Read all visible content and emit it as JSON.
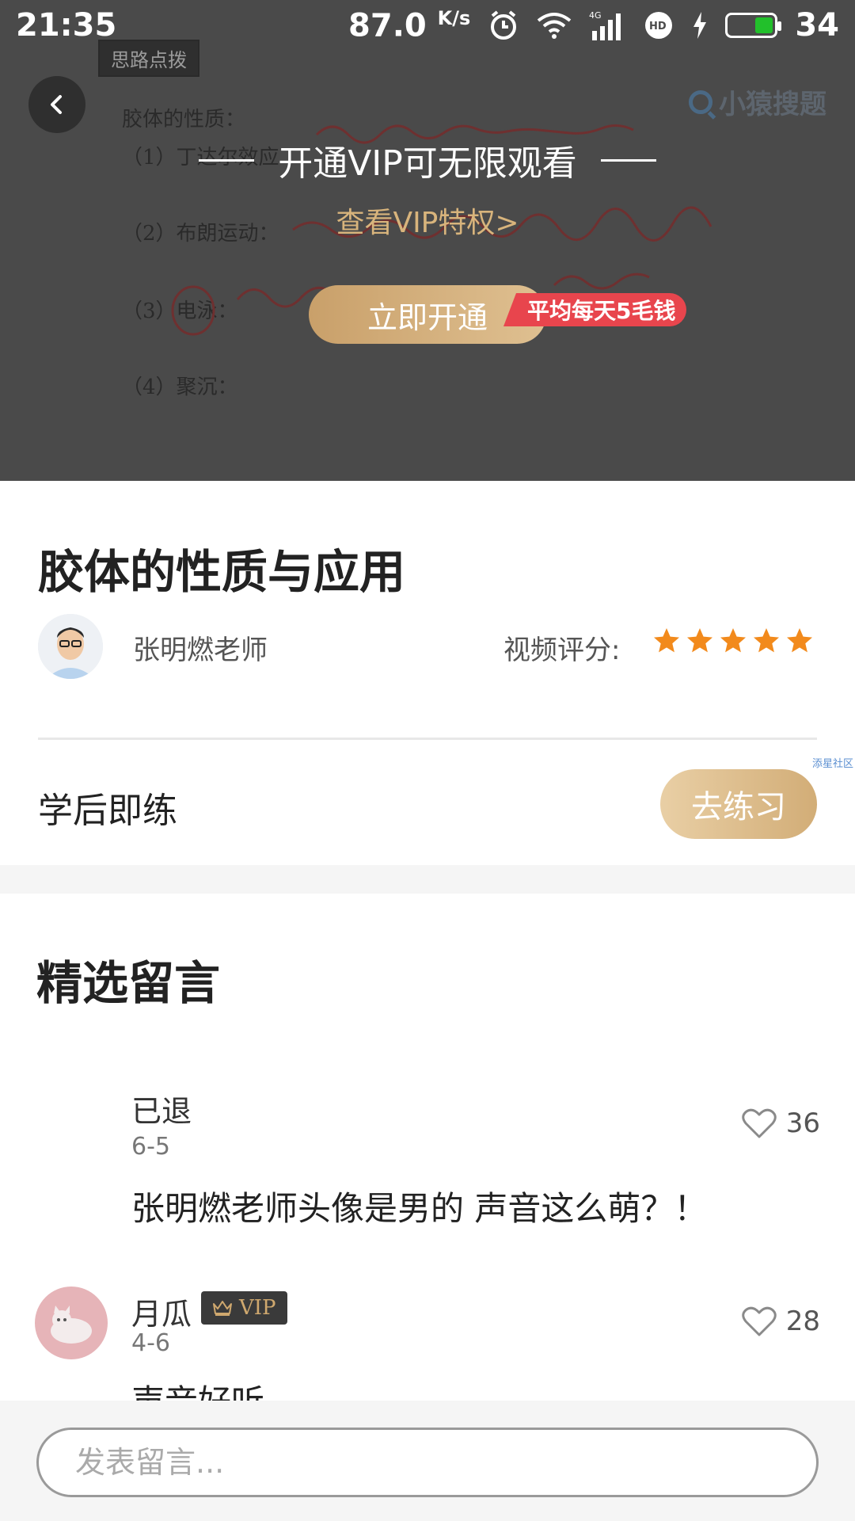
{
  "status_bar": {
    "time": "21:35",
    "speed": "87.0",
    "speed_unit": "K/s",
    "battery": "34",
    "icons": [
      "alarm-icon",
      "wifi-icon",
      "signal-4g-icon",
      "hd-icon",
      "charging-icon",
      "battery-icon"
    ]
  },
  "video": {
    "board_tag": "思路点拨",
    "board_logo": "小猿搜题",
    "board_title": "胶体的性质：",
    "board_lines": [
      "（1）丁达尔效应",
      "（2）布朗运动：",
      "（3）电泳：",
      "（4）聚沉："
    ],
    "vip_title": "开通VIP可无限观看",
    "vip_link": "查看VIP特权>",
    "open_button": "立即开通",
    "promo_badge": "平均每天5毛钱"
  },
  "lesson": {
    "title": "胶体的性质与应用",
    "teacher": "张明燃老师",
    "rating_label": "视频评分:",
    "rating": 5,
    "rating_max": 5,
    "watermark": "添星社区",
    "practice_label": "学后即练",
    "practice_button": "去练习"
  },
  "comments": {
    "title": "精选留言",
    "items": [
      {
        "user": "已退",
        "date": "6-5",
        "likes": "36",
        "text": "张明燃老师头像是男的 声音这么萌？！",
        "vip": false
      },
      {
        "user": "月瓜",
        "date": "4-6",
        "likes": "28",
        "text": "声音好听",
        "vip": true,
        "vip_label": "VIP"
      }
    ]
  },
  "bottom": {
    "input_placeholder": "发表留言..."
  },
  "colors": {
    "gold": "#d2ad77",
    "promo_red": "#e8454d",
    "star_orange": "#f28a1c",
    "overlay": "#4a4a4a"
  }
}
